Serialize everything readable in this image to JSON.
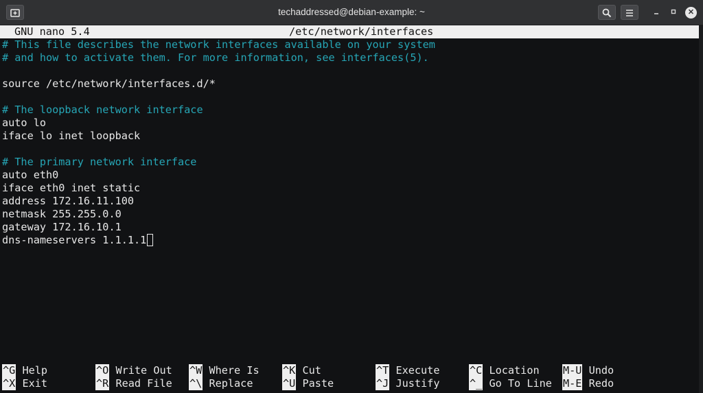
{
  "window": {
    "title": "techaddressed@debian-example: ~",
    "new_tab_icon": "new-tab-icon",
    "search_icon": "search-icon",
    "menu_icon": "hamburger-menu-icon",
    "minimize_icon": "minimize-icon",
    "maximize_icon": "maximize-icon",
    "close_icon": "close-icon"
  },
  "nano": {
    "version": "GNU nano 5.4",
    "filename": "/etc/network/interfaces"
  },
  "file_lines": [
    "# This file describes the network interfaces available on your system",
    "# and how to activate them. For more information, see interfaces(5).",
    "",
    "source /etc/network/interfaces.d/*",
    "",
    "# The loopback network interface",
    "auto lo",
    "iface lo inet loopback",
    "",
    "# The primary network interface",
    "auto eth0",
    "iface eth0 inet static",
    "address 172.16.11.100",
    "netmask 255.255.0.0",
    "gateway 172.16.10.1",
    "dns-nameservers 1.1.1.1"
  ],
  "shortcuts": [
    {
      "key": "^G",
      "label": "Help"
    },
    {
      "key": "^O",
      "label": "Write Out"
    },
    {
      "key": "^W",
      "label": "Where Is"
    },
    {
      "key": "^K",
      "label": "Cut"
    },
    {
      "key": "^T",
      "label": "Execute"
    },
    {
      "key": "^C",
      "label": "Location"
    },
    {
      "key": "M-U",
      "label": "Undo"
    },
    {
      "key": "^X",
      "label": "Exit"
    },
    {
      "key": "^R",
      "label": "Read File"
    },
    {
      "key": "^\\",
      "label": "Replace"
    },
    {
      "key": "^U",
      "label": "Paste"
    },
    {
      "key": "^J",
      "label": "Justify"
    },
    {
      "key": "^_",
      "label": "Go To Line"
    },
    {
      "key": "M-E",
      "label": "Redo"
    }
  ],
  "colors": {
    "comment": "#26a6b6",
    "text": "#e8e8e8",
    "background": "#111214",
    "titlebar": "#303133"
  }
}
